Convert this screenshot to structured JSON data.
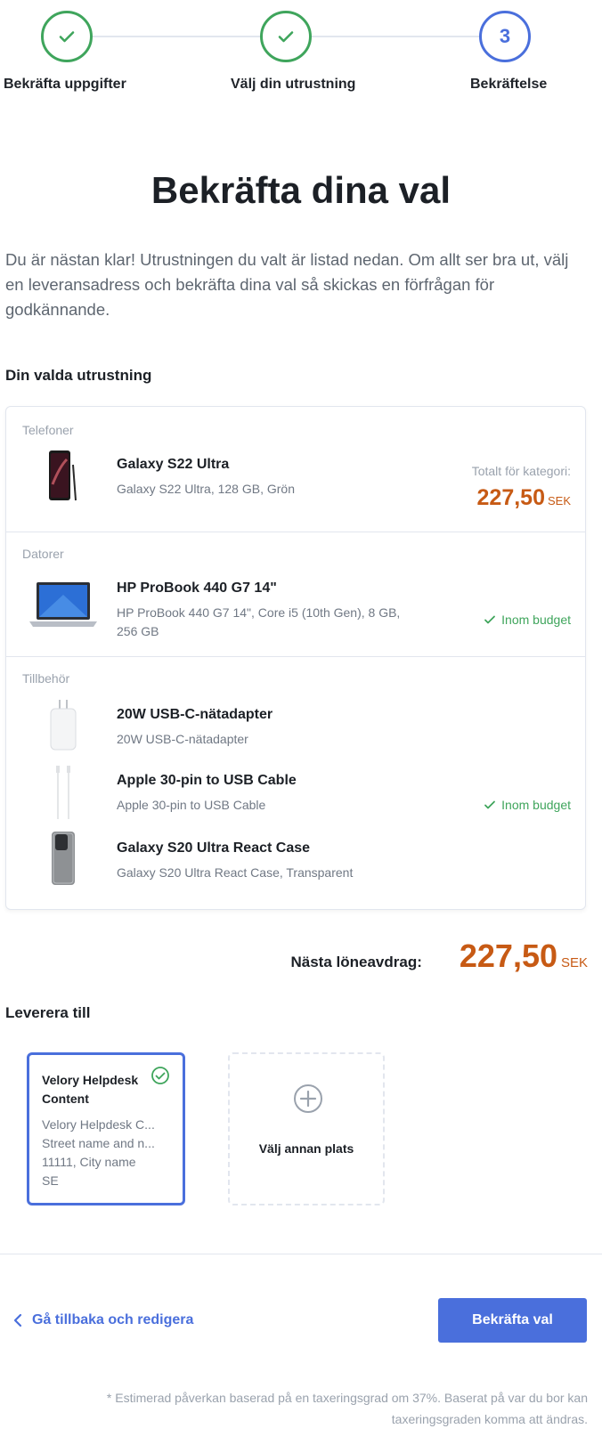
{
  "stepper": {
    "steps": [
      {
        "label": "Bekräfta uppgifter",
        "state": "done"
      },
      {
        "label": "Välj din utrustning",
        "state": "done"
      },
      {
        "label": "Bekräftelse",
        "state": "active",
        "number": "3"
      }
    ]
  },
  "title": "Bekräfta dina val",
  "intro": "Du är nästan klar! Utrustningen du valt är listad nedan. Om allt ser bra ut, välj en leveransadress och bekräfta dina val så skickas en förfrågan för godkännande.",
  "equipment": {
    "heading": "Din valda utrustning",
    "categories": [
      {
        "label": "Telefoner",
        "total_label": "Totalt för kategori:",
        "total_value": "227,50",
        "total_currency": "SEK",
        "products": [
          {
            "name": "Galaxy S22 Ultra",
            "desc": "Galaxy S22 Ultra, 128 GB, Grön",
            "icon": "phone-image"
          }
        ]
      },
      {
        "label": "Datorer",
        "budget": "Inom budget",
        "products": [
          {
            "name": "HP ProBook 440 G7 14\"",
            "desc": "HP ProBook 440 G7 14\", Core i5 (10th Gen), 8 GB, 256 GB",
            "icon": "laptop-image"
          }
        ]
      },
      {
        "label": "Tillbehör",
        "budget": "Inom budget",
        "products": [
          {
            "name": "20W USB-C-nätadapter",
            "desc": "20W USB-C-nätadapter",
            "icon": "adapter-image"
          },
          {
            "name": "Apple 30-pin to USB Cable",
            "desc": "Apple 30-pin to USB Cable",
            "icon": "cable-image"
          },
          {
            "name": "Galaxy S20 Ultra React Case",
            "desc": "Galaxy S20 Ultra React Case, Transparent",
            "icon": "case-image"
          }
        ]
      }
    ]
  },
  "deduction": {
    "label": "Nästa löneavdrag:",
    "amount": "227,50",
    "currency": "SEK"
  },
  "delivery": {
    "heading": "Leverera till",
    "selected": {
      "name": "Velory Helpdesk Content",
      "line1": "Velory Helpdesk C...",
      "line2": "Street name and n...",
      "line3": "11111, City name",
      "line4": "SE"
    },
    "other_label": "Välj annan plats"
  },
  "actions": {
    "back": "Gå tillbaka och redigera",
    "confirm": "Bekräfta val"
  },
  "footnote": "* Estimerad påverkan baserad på en taxeringsgrad om 37%. Baserat på var du bor kan taxeringsgraden komma att ändras.",
  "colors": {
    "accent": "#4a6fdc",
    "success": "#3fa55c",
    "price": "#c75a14"
  }
}
